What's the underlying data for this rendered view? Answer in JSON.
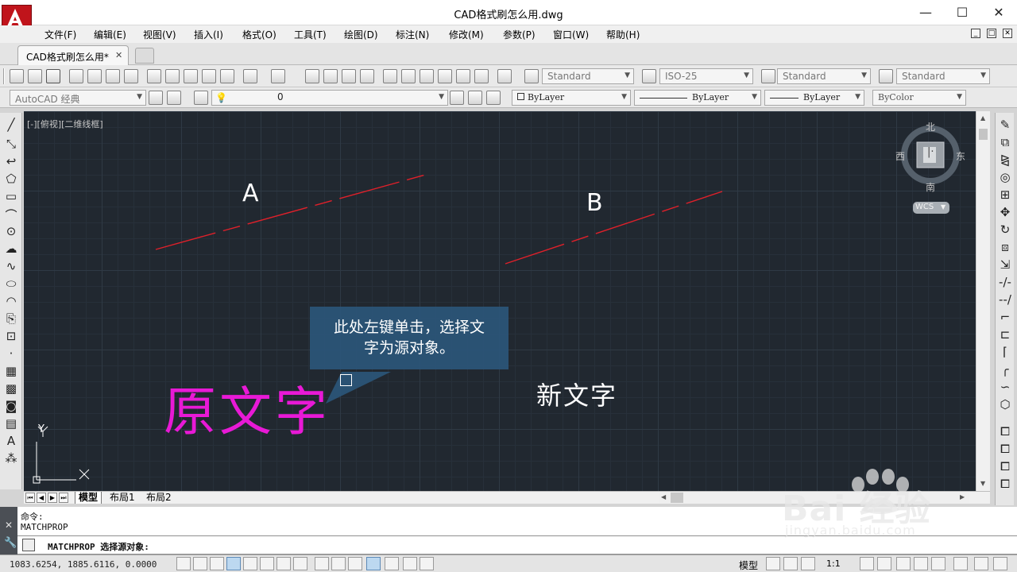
{
  "window": {
    "title": "CAD格式刷怎么用.dwg",
    "minimize": "—",
    "maximize": "☐",
    "close": "✕"
  },
  "menu": [
    "文件(F)",
    "编辑(E)",
    "视图(V)",
    "插入(I)",
    "格式(O)",
    "工具(T)",
    "绘图(D)",
    "标注(N)",
    "修改(M)",
    "参数(P)",
    "窗口(W)",
    "帮助(H)"
  ],
  "mdi": [
    "_",
    "□",
    "✕"
  ],
  "doc_tab": {
    "label": "CAD格式刷怎么用*",
    "close": "✕"
  },
  "styles": {
    "text_style": "Standard",
    "dim_style": "ISO-25",
    "table_style": "Standard",
    "multileader_style": "Standard"
  },
  "workspace": "AutoCAD 经典",
  "layer": {
    "name": "0"
  },
  "properties": {
    "color": "ByLayer",
    "linetype": "ByLayer",
    "lineweight": "ByLayer",
    "plotstyle": "ByColor"
  },
  "viewport_label": "[-][俯视][二维线框]",
  "viewcube": {
    "north": "北",
    "south": "南",
    "east": "东",
    "west": "西",
    "wcs": "WCS"
  },
  "drawing": {
    "label_a": "A",
    "label_b": "B",
    "line_color": "#e0202a",
    "original_text": "原文字",
    "original_text_color": "#e819d6",
    "new_text": "新文字"
  },
  "callout": {
    "line1": "此处左键单击，选择文",
    "line2": "字为源对象。"
  },
  "ucs": {
    "x": "X",
    "y": "Y"
  },
  "layout_tabs": [
    "模型",
    "布局1",
    "布局2"
  ],
  "command": {
    "history": [
      "命令:",
      "MATCHPROP"
    ],
    "prompt": "MATCHPROP 选择源对象:"
  },
  "status": {
    "coords": "1083.6254, 1885.6116, 0.0000",
    "space": "模型",
    "scale": "1:1"
  },
  "watermark": {
    "brand": "Bai  经验",
    "url": "jingyan.baidu.com"
  }
}
